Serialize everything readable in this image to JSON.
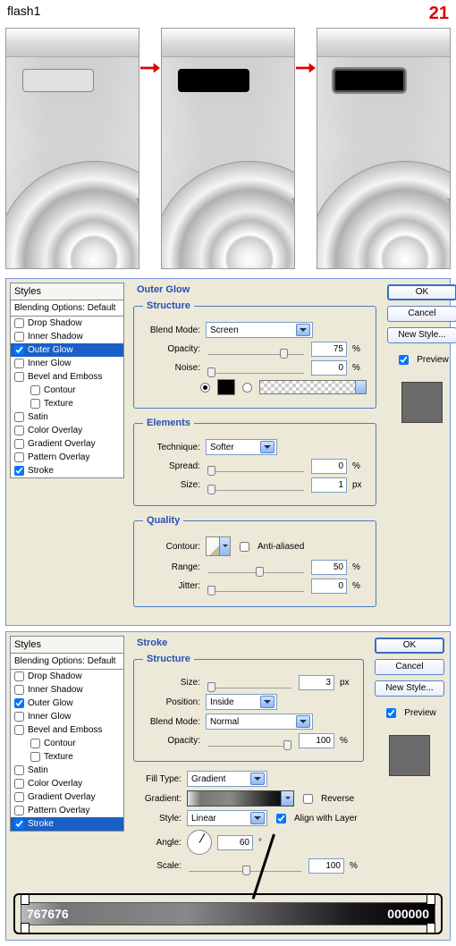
{
  "header": {
    "layer_name": "flash1",
    "step_number": "21"
  },
  "styles_panel": {
    "title": "Styles",
    "subtitle": "Blending Options: Default",
    "items": [
      {
        "label": "Drop Shadow",
        "checked": false
      },
      {
        "label": "Inner Shadow",
        "checked": false
      },
      {
        "label": "Outer Glow",
        "checked": true
      },
      {
        "label": "Inner Glow",
        "checked": false
      },
      {
        "label": "Bevel and Emboss",
        "checked": false
      },
      {
        "label": "Contour",
        "checked": false,
        "indent": true
      },
      {
        "label": "Texture",
        "checked": false,
        "indent": true
      },
      {
        "label": "Satin",
        "checked": false
      },
      {
        "label": "Color Overlay",
        "checked": false
      },
      {
        "label": "Gradient Overlay",
        "checked": false
      },
      {
        "label": "Pattern Overlay",
        "checked": false
      },
      {
        "label": "Stroke",
        "checked": true
      }
    ]
  },
  "outer_glow": {
    "title": "Outer Glow",
    "structure": {
      "heading": "Structure",
      "blend_mode_label": "Blend Mode:",
      "blend_mode": "Screen",
      "opacity_label": "Opacity:",
      "opacity": "75",
      "opacity_unit": "%",
      "noise_label": "Noise:",
      "noise": "0",
      "noise_unit": "%"
    },
    "elements": {
      "heading": "Elements",
      "technique_label": "Technique:",
      "technique": "Softer",
      "spread_label": "Spread:",
      "spread": "0",
      "spread_unit": "%",
      "size_label": "Size:",
      "size": "1",
      "size_unit": "px"
    },
    "quality": {
      "heading": "Quality",
      "contour_label": "Contour:",
      "antialiased_label": "Anti-aliased",
      "range_label": "Range:",
      "range": "50",
      "range_unit": "%",
      "jitter_label": "Jitter:",
      "jitter": "0",
      "jitter_unit": "%"
    }
  },
  "stroke": {
    "title": "Stroke",
    "structure": {
      "heading": "Structure",
      "size_label": "Size:",
      "size": "3",
      "size_unit": "px",
      "position_label": "Position:",
      "position": "Inside",
      "blend_mode_label": "Blend Mode:",
      "blend_mode": "Normal",
      "opacity_label": "Opacity:",
      "opacity": "100",
      "opacity_unit": "%"
    },
    "fill": {
      "fill_type_label": "Fill Type:",
      "fill_type": "Gradient",
      "gradient_label": "Gradient:",
      "reverse_label": "Reverse",
      "style_label": "Style:",
      "style": "Linear",
      "align_label": "Align with Layer",
      "angle_label": "Angle:",
      "angle": "60",
      "angle_unit": "°",
      "scale_label": "Scale:",
      "scale": "100",
      "scale_unit": "%"
    },
    "gradient_stops": {
      "left": "767676",
      "right": "000000"
    }
  },
  "buttons": {
    "ok": "OK",
    "cancel": "Cancel",
    "new_style": "New Style...",
    "preview": "Preview"
  }
}
